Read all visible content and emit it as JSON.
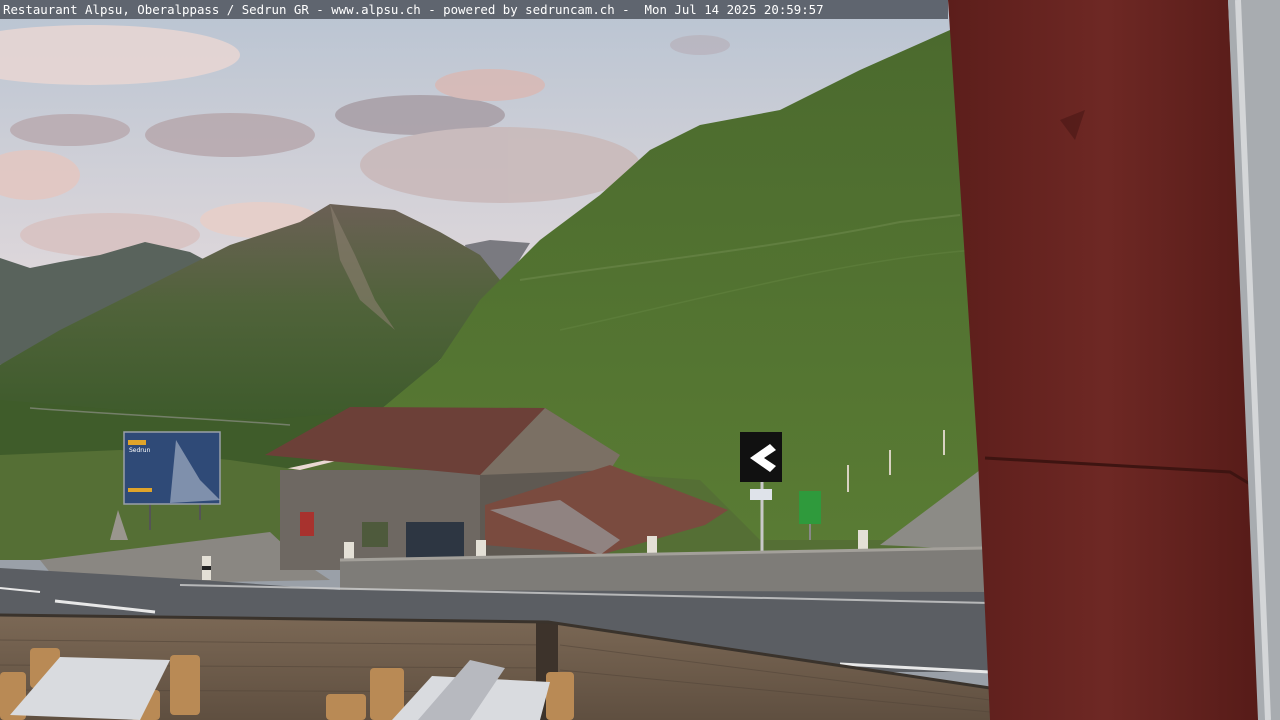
{
  "webcam": {
    "overlay_caption": "Restaurant Alpsu, Oberalppass / Sedrun GR - www.alpsu.ch - powered by sedruncam.ch -  Mon Jul 14 2025 20:59:57"
  },
  "billboard": {
    "brand": "Sedrun",
    "line_1": "Sedrun",
    "line_2": ""
  },
  "colors": {
    "sky_top": "#c7d0dc",
    "sky_bottom": "#e6d9d6",
    "mountain_green": "#4a6e2c",
    "roof_rust": "#6e3f36",
    "pillar_red": "#6a2420",
    "road": "#5a5d62"
  }
}
